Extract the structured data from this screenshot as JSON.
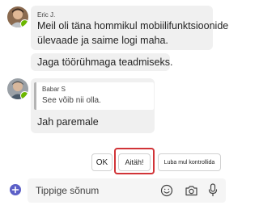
{
  "messages": [
    {
      "sender": "Eric J.",
      "lines": [
        "Meil oli täna hommikul mobiilifunktsioonide",
        "ülevaade ja saime logi maha."
      ],
      "followup": "Jaga töörühmaga teadmiseks."
    },
    {
      "sender": "Babar S",
      "quote_text": "See võib nii olla.",
      "reply": "Jah paremale"
    }
  ],
  "suggested_replies": [
    "OK",
    "Aitäh!",
    "Luba mul kontrollida"
  ],
  "composer": {
    "placeholder": "Tippige sõnum"
  },
  "icons": {
    "add": "add-circle-icon",
    "emoji": "emoji-icon",
    "camera": "camera-icon",
    "mic": "microphone-icon"
  },
  "colors": {
    "presence": "#6bb700",
    "accent": "#5b5fc7",
    "highlight": "#d13438",
    "bubble": "#f0f0f0"
  }
}
